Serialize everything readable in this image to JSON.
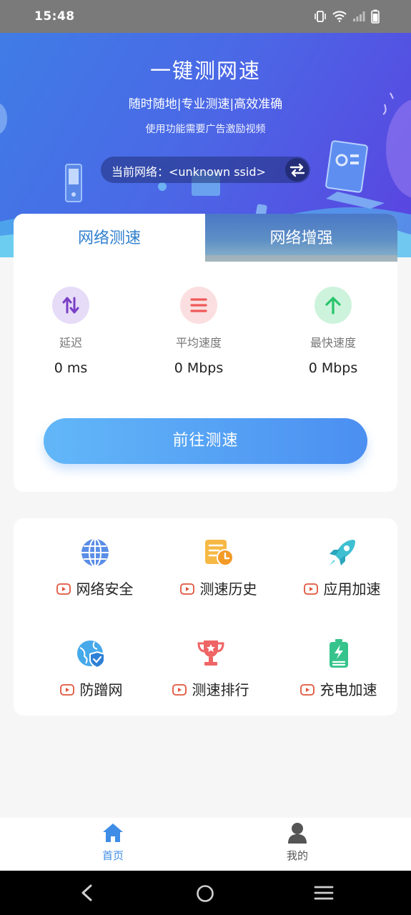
{
  "status_bar": {
    "time": "15:48",
    "icons": [
      "vibrate-icon",
      "wifi-icon",
      "signal-icon",
      "battery-icon"
    ]
  },
  "hero": {
    "title": "一键测网速",
    "subtitle": "随时随地|专业测速|高效准确",
    "note": "使用功能需要广告激励视频",
    "network_label": "当前网络：<unknown ssid>",
    "switch_icon": "swap-arrows-icon"
  },
  "tabs": [
    {
      "label": "网络测速",
      "active": true
    },
    {
      "label": "网络增强",
      "active": false
    }
  ],
  "metrics": [
    {
      "label": "延迟",
      "value": "0 ms",
      "icon": "up-down-arrows-icon",
      "color": "#7a3fc6"
    },
    {
      "label": "平均速度",
      "value": "0 Mbps",
      "icon": "list-lines-icon",
      "color": "#ef5a5a"
    },
    {
      "label": "最快速度",
      "value": "0 Mbps",
      "icon": "arrow-up-icon",
      "color": "#27c46b"
    }
  ],
  "cta_label": "前往测速",
  "features": [
    {
      "label": "网络安全",
      "icon": "globe-icon"
    },
    {
      "label": "测速历史",
      "icon": "history-clock-icon"
    },
    {
      "label": "应用加速",
      "icon": "rocket-icon"
    },
    {
      "label": "防蹭网",
      "icon": "globe-shield-icon"
    },
    {
      "label": "测速排行",
      "icon": "trophy-icon"
    },
    {
      "label": "充电加速",
      "icon": "battery-charge-icon"
    }
  ],
  "feature_badge_icon": "video-play-icon",
  "bottom_nav": [
    {
      "label": "首页",
      "icon": "home-icon",
      "active": true
    },
    {
      "label": "我的",
      "icon": "person-icon",
      "active": false
    }
  ],
  "system_nav": [
    "back-icon",
    "home-circle-icon",
    "menu-icon"
  ],
  "colors": {
    "accent": "#2f7fce",
    "hero_start": "#3f7ce6",
    "hero_end": "#5a43e0",
    "cta_start": "#62b7f8",
    "cta_end": "#4b8ff1",
    "video_badge": "#e0553c"
  }
}
